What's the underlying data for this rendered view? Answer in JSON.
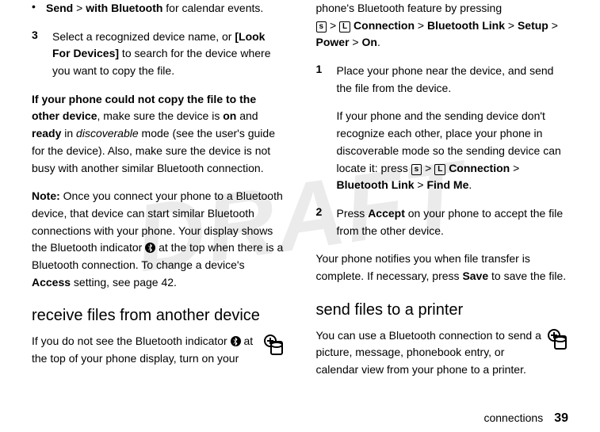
{
  "watermark": "DRAFT",
  "left": {
    "bullet1_a": "Send",
    "bullet1_gt": " > ",
    "bullet1_b": "with Bluetooth",
    "bullet1_c": " for calendar events.",
    "step3_num": "3",
    "step3_a": "Select a recognized device name, or ",
    "step3_b": "[Look For Devices]",
    "step3_c": " to search for the device where you want to copy the file.",
    "para1_a": "If your phone could not copy the file to the other device",
    "para1_b": ", make sure the device is ",
    "para1_c": "on",
    "para1_d": " and ",
    "para1_e": "ready",
    "para1_f": " in ",
    "para1_g": "discoverable",
    "para1_h": " mode (see the user's guide for the device). Also, make sure the device is not busy with another similar Bluetooth connection.",
    "para2_a": "Note:",
    "para2_b": " Once you connect your phone to a Bluetooth device, that device can start similar Bluetooth connections with your phone. Your display shows the Bluetooth indicator ",
    "para2_c": " at the top when there is a Bluetooth connection. To change a device's ",
    "para2_d": "Access",
    "para2_e": " setting, see page 42.",
    "h2": "receive files from another device",
    "para3_a": "If you do not see the Bluetooth indicator ",
    "para3_b": " at the top of your phone display, turn on your "
  },
  "right": {
    "para1_a": "phone's Bluetooth feature by pressing ",
    "para1_key": "s",
    "para1_gt": " > ",
    "para1_conn_icon": "L",
    "para1_b": "Connection",
    "para1_c": "Bluetooth Link",
    "para1_d": "Setup",
    "para1_e": "Power",
    "para1_f": "On",
    "step1_num": "1",
    "step1_a": "Place your phone near the device, and send the file from the device.",
    "step1_b": "If your phone and the sending device don't recognize each other, place your phone in discoverable mode so the sending device can locate it: press ",
    "step1_c": "Connection",
    "step1_d": "Bluetooth Link",
    "step1_e": "Find Me",
    "step2_num": "2",
    "step2_a": "Press ",
    "step2_b": "Accept",
    "step2_c": " on your phone to accept the file from the other device.",
    "para2_a": "Your phone notifies you when file transfer is complete. If necessary, press ",
    "para2_b": "Save",
    "para2_c": " to save the file.",
    "h2": "send files to a printer",
    "para3_a": "You can use a Bluetooth connection to send a picture, message, phonebook entry, or calendar view from your phone to a printer."
  },
  "footer": {
    "section": "connections",
    "page": "39"
  }
}
